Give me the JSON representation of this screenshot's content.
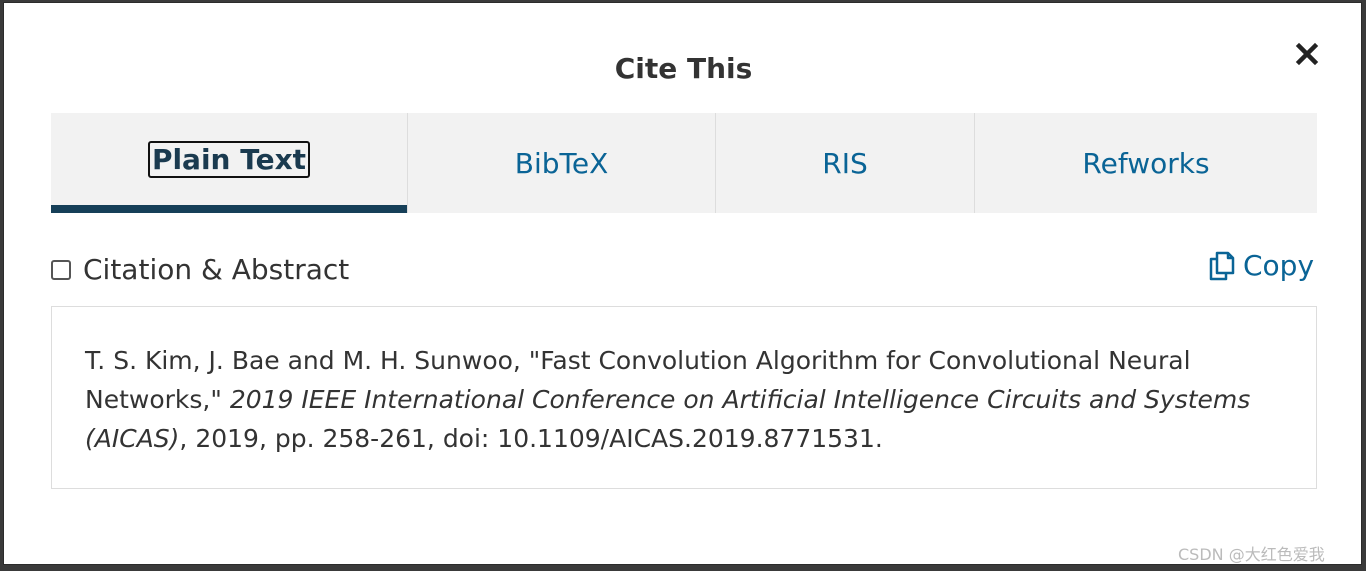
{
  "dialog": {
    "title": "Cite This",
    "close_label": "×"
  },
  "tabs": [
    {
      "label": "Plain Text",
      "active": true
    },
    {
      "label": "BibTeX",
      "active": false
    },
    {
      "label": "RIS",
      "active": false
    },
    {
      "label": "Refworks",
      "active": false
    }
  ],
  "options": {
    "checkbox_label": "Citation & Abstract",
    "checked": false,
    "copy_label": "Copy",
    "copy_icon": "copy-icon"
  },
  "citation": {
    "part1": "T. S. Kim, J. Bae and M. H. Sunwoo, \"Fast Convolution Algorithm for Convolutional Neural Networks,\" ",
    "journal": "2019 IEEE International Conference on Artificial Intelligence Circuits and Systems (AICAS)",
    "part2": ", 2019, pp. 258-261, doi: 10.1109/AICAS.2019.8771531."
  },
  "watermark": "CSDN @大红色爱我",
  "colors": {
    "accent": "#0a6496",
    "active_underline": "#163f58",
    "tab_bg": "#f2f2f2"
  }
}
